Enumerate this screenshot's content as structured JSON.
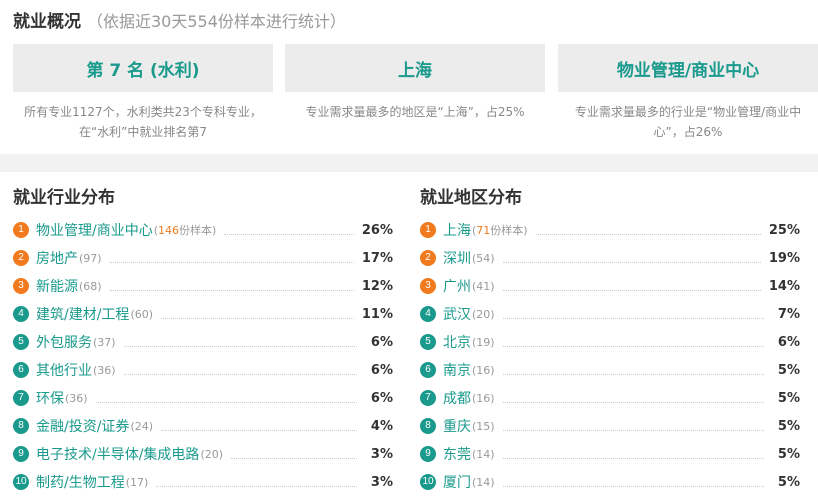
{
  "overview": {
    "title": "就业概况",
    "subtitle": "（依据近30天554份样本进行统计）"
  },
  "cards": [
    {
      "value": "第 7 名 (水利)",
      "desc": "所有专业1127个，水利类共23个专科专业，在“水利”中就业排名第7"
    },
    {
      "value": "上海",
      "desc": "专业需求量最多的地区是“上海”，占25%"
    },
    {
      "value": "物业管理/商业中心",
      "desc": "专业需求量最多的行业是“物业管理/商业中心”，占26%"
    }
  ],
  "industry": {
    "title": "就业行业分布",
    "rows": [
      {
        "rank": "1",
        "name": "物业管理/商业中心",
        "count": "146",
        "count_suffix": "份样本",
        "pct": "26%"
      },
      {
        "rank": "2",
        "name": "房地产",
        "count": "(97)",
        "pct": "17%"
      },
      {
        "rank": "3",
        "name": "新能源",
        "count": "(68)",
        "pct": "12%"
      },
      {
        "rank": "4",
        "name": "建筑/建材/工程",
        "count": "(60)",
        "pct": "11%"
      },
      {
        "rank": "5",
        "name": "外包服务",
        "count": "(37)",
        "pct": "6%"
      },
      {
        "rank": "6",
        "name": "其他行业",
        "count": "(36)",
        "pct": "6%"
      },
      {
        "rank": "7",
        "name": "环保",
        "count": "(36)",
        "pct": "6%"
      },
      {
        "rank": "8",
        "name": "金融/投资/证券",
        "count": "(24)",
        "pct": "4%"
      },
      {
        "rank": "9",
        "name": "电子技术/半导体/集成电路",
        "count": "(20)",
        "pct": "3%"
      },
      {
        "rank": "10",
        "name": "制药/生物工程",
        "count": "(17)",
        "pct": "3%"
      }
    ]
  },
  "region": {
    "title": "就业地区分布",
    "rows": [
      {
        "rank": "1",
        "name": "上海",
        "count": "71",
        "count_suffix": "份样本",
        "pct": "25%"
      },
      {
        "rank": "2",
        "name": "深圳",
        "count": "(54)",
        "pct": "19%"
      },
      {
        "rank": "3",
        "name": "广州",
        "count": "(41)",
        "pct": "14%"
      },
      {
        "rank": "4",
        "name": "武汉",
        "count": "(20)",
        "pct": "7%"
      },
      {
        "rank": "5",
        "name": "北京",
        "count": "(19)",
        "pct": "6%"
      },
      {
        "rank": "6",
        "name": "南京",
        "count": "(16)",
        "pct": "5%"
      },
      {
        "rank": "7",
        "name": "成都",
        "count": "(16)",
        "pct": "5%"
      },
      {
        "rank": "8",
        "name": "重庆",
        "count": "(15)",
        "pct": "5%"
      },
      {
        "rank": "9",
        "name": "东莞",
        "count": "(14)",
        "pct": "5%"
      },
      {
        "rank": "10",
        "name": "厦门",
        "count": "(14)",
        "pct": "5%"
      }
    ]
  },
  "colors": {
    "accent": "#1a9a8c",
    "rank_hot": "#f07a1d",
    "card_bg": "#ececec"
  }
}
